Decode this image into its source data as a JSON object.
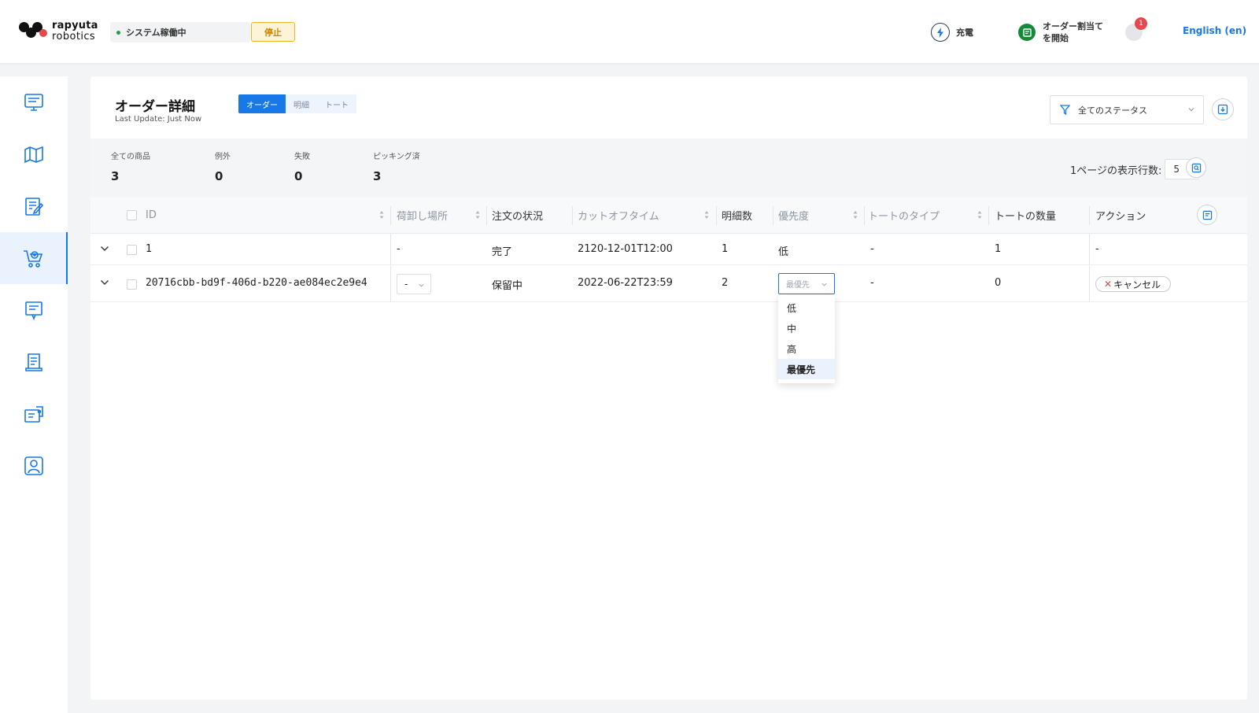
{
  "header": {
    "logo": {
      "line1": "rapyuta",
      "line2": "robotics"
    },
    "system_status": "システム稼働中",
    "stop_label": "停止",
    "charge_label": "充電",
    "order_assign": {
      "line1": "オーダー割当て",
      "line2": "を開始"
    },
    "notification_count": "1",
    "language": "English (en)"
  },
  "sidebar": {
    "active_index": 3,
    "items": [
      "dashboard-icon",
      "map-icon",
      "notepad-icon",
      "cart-icon",
      "report-icon",
      "document-icon",
      "device-icon",
      "user-icon"
    ]
  },
  "page": {
    "title": "オーダー詳細",
    "last_update": "Last Update: Just Now",
    "tabs": [
      {
        "label": "オーダー",
        "active": true
      },
      {
        "label": "明細",
        "active": false
      },
      {
        "label": "トート",
        "active": false
      }
    ],
    "status_filter": "全てのステータス",
    "rows_per_page_label": "1ページの表示行数:",
    "rows_per_page_value": "5"
  },
  "stats": [
    {
      "label": "全ての商品",
      "value": "3"
    },
    {
      "label": "例外",
      "value": "0"
    },
    {
      "label": "失敗",
      "value": "0"
    },
    {
      "label": "ピッキング済",
      "value": "3"
    }
  ],
  "table": {
    "columns": [
      {
        "label": "ID",
        "muted": true
      },
      {
        "label": "荷卸し場所",
        "muted": true
      },
      {
        "label": "注文の状況",
        "muted": false
      },
      {
        "label": "カットオフタイム",
        "muted": true
      },
      {
        "label": "明細数",
        "muted": false
      },
      {
        "label": "優先度",
        "muted": true
      },
      {
        "label": "トートのタイプ",
        "muted": true
      },
      {
        "label": "トートの数量",
        "muted": false
      },
      {
        "label": "アクション",
        "muted": false
      }
    ],
    "rows": [
      {
        "id": "1",
        "unload": "-",
        "status": "完了",
        "cutoff": "2120-12-01T12:00",
        "lines": "1",
        "priority": "低",
        "tote_type": "-",
        "tote_qty": "1",
        "action": "-"
      },
      {
        "id": "20716cbb-bd9f-406d-b220-ae084ec2e9e4",
        "unload": "-",
        "status": "保留中",
        "cutoff": "2022-06-22T23:59",
        "lines": "2",
        "priority": "最優先",
        "tote_type": "-",
        "tote_qty": "0",
        "action": "キャンセル"
      }
    ]
  },
  "priority_dropdown": {
    "options": [
      "低",
      "中",
      "高",
      "最優先"
    ],
    "selected": "最優先"
  },
  "colors": {
    "accent": "#1778e6",
    "ok": "#1f9b4a",
    "warn": "#f0b429",
    "danger": "#e5484d"
  }
}
